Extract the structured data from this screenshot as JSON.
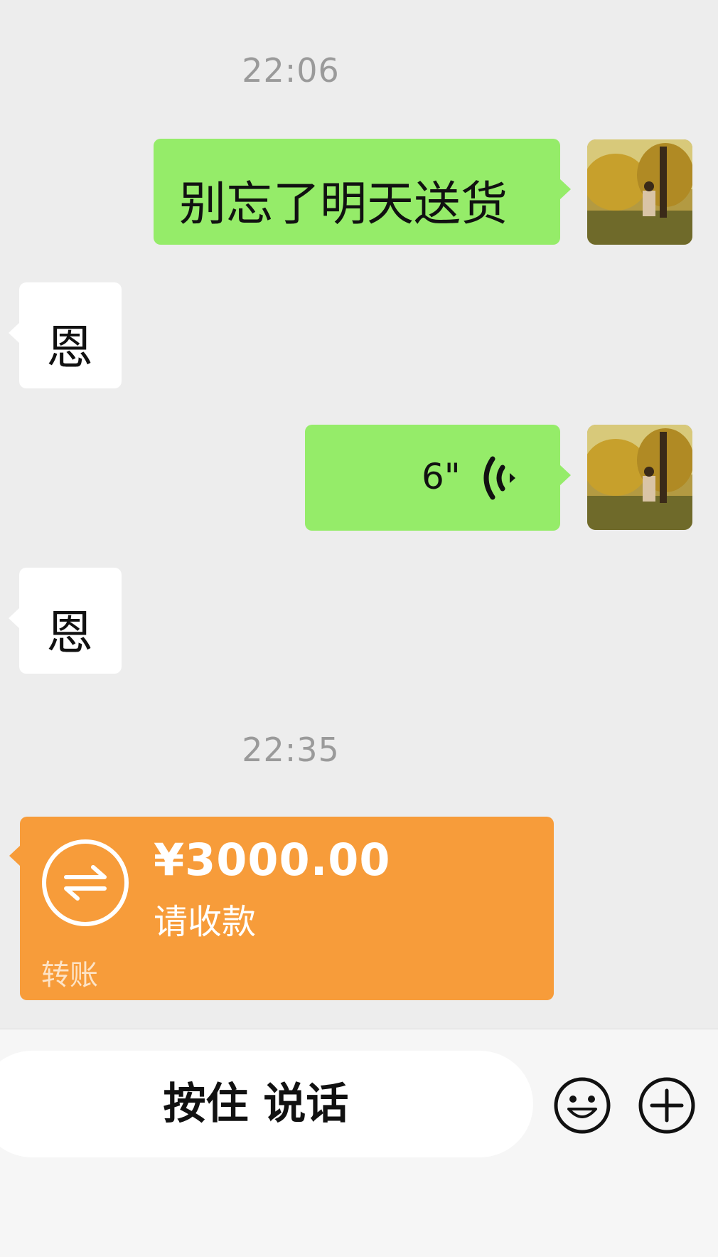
{
  "chat": {
    "timestamp_1": "22:06",
    "msg_1": "别忘了明天送货",
    "reply_1": "恩",
    "voice_duration": "6\"",
    "reply_2": "恩",
    "timestamp_2": "22:35",
    "transfer": {
      "amount": "¥3000.00",
      "note": "请收款",
      "label": "转账"
    }
  },
  "input_bar": {
    "hold_to_talk": "按住 说话"
  },
  "icons": {
    "voice": "voice-wave-icon",
    "transfer": "transfer-arrows-icon",
    "emoji": "emoji-icon",
    "add": "plus-icon"
  },
  "colors": {
    "background": "#ededed",
    "sent_bubble": "#95ec69",
    "received_bubble": "#ffffff",
    "transfer": "#f79c3a",
    "timestamp": "#9a9a9a"
  }
}
